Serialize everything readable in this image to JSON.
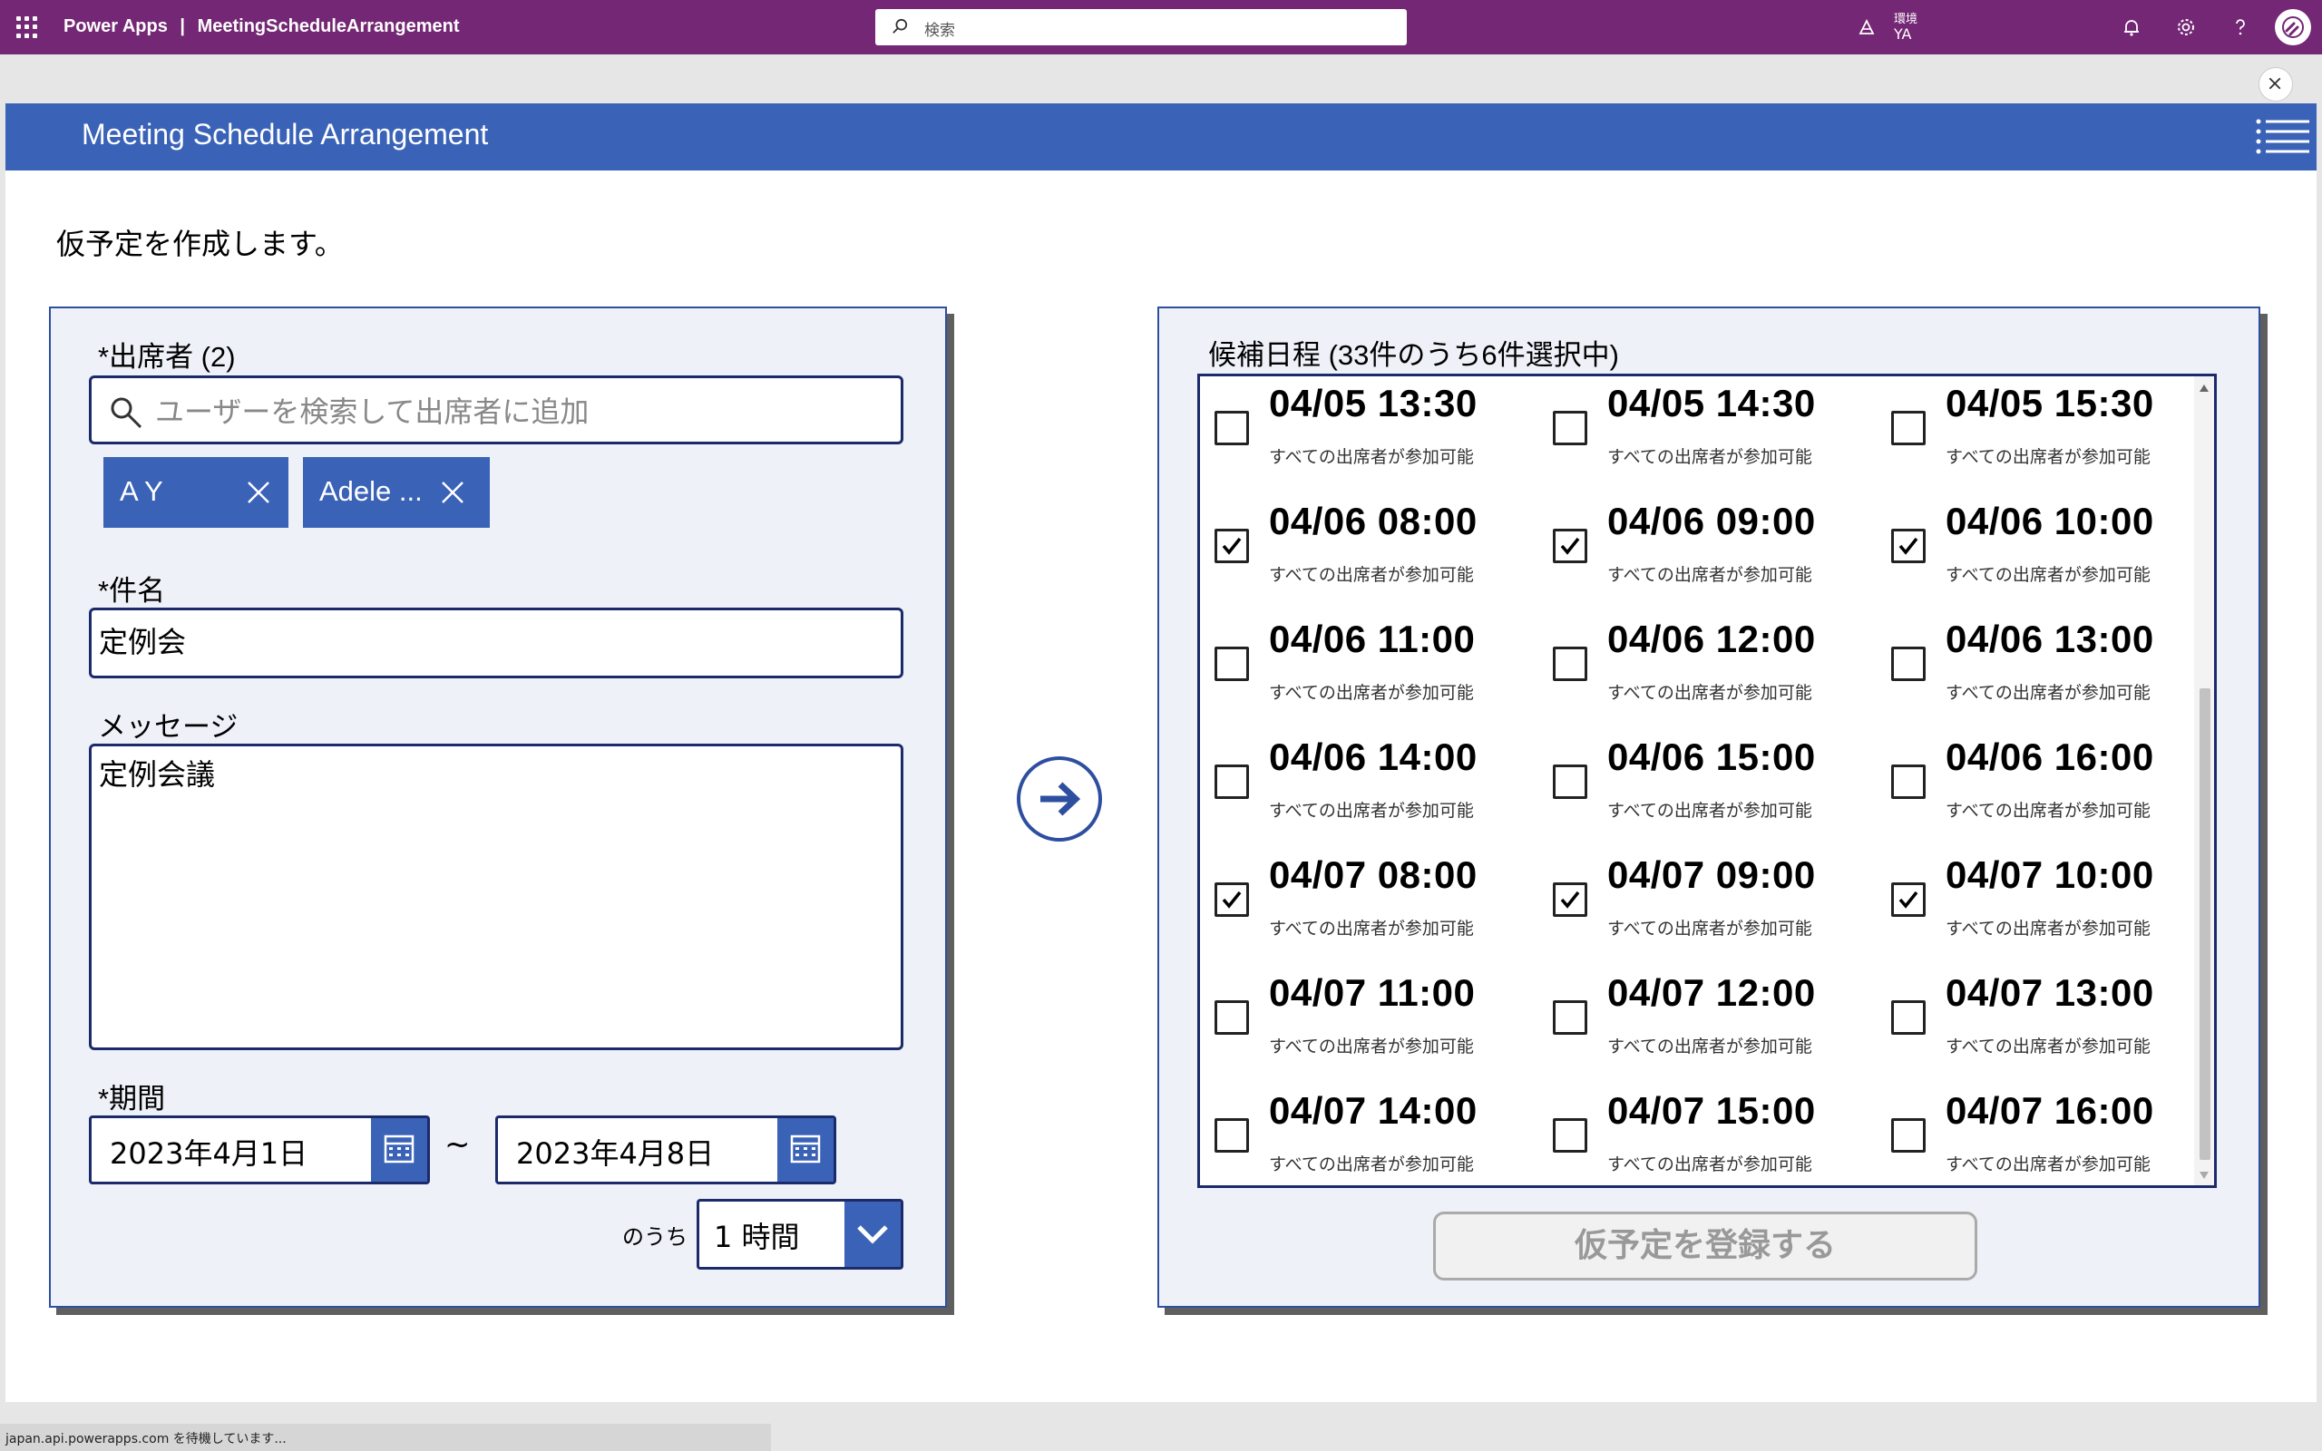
{
  "topbar": {
    "app_name": "Power Apps",
    "separator": "|",
    "app_title": "MeetingScheduleArrangement",
    "search_placeholder": "検索",
    "env_label": "環境",
    "env_value": "YA"
  },
  "app": {
    "header_title": "Meeting Schedule Arrangement",
    "intro": "仮予定を作成します。",
    "attendees": {
      "label": "*出席者 (2)",
      "search_placeholder": "ユーザーを検索して出席者に追加",
      "chips": [
        "A Y",
        "Adele ..."
      ]
    },
    "subject": {
      "label": "*件名",
      "value": "定例会"
    },
    "message": {
      "label": "メッセージ",
      "value": "定例会議"
    },
    "period": {
      "label": "*期間",
      "start": "2023年4月1日",
      "separator": "~",
      "end": "2023年4月8日",
      "duration_prefix": "のうち",
      "duration": "1 時間"
    },
    "candidates": {
      "label": "候補日程 (33件のうち6件選択中)",
      "availability_text": "すべての出席者が参加可能",
      "slots": [
        {
          "time": "04/05 13:30",
          "checked": false
        },
        {
          "time": "04/05 14:30",
          "checked": false
        },
        {
          "time": "04/05 15:30",
          "checked": false
        },
        {
          "time": "04/06 08:00",
          "checked": true
        },
        {
          "time": "04/06 09:00",
          "checked": true
        },
        {
          "time": "04/06 10:00",
          "checked": true
        },
        {
          "time": "04/06 11:00",
          "checked": false
        },
        {
          "time": "04/06 12:00",
          "checked": false
        },
        {
          "time": "04/06 13:00",
          "checked": false
        },
        {
          "time": "04/06 14:00",
          "checked": false
        },
        {
          "time": "04/06 15:00",
          "checked": false
        },
        {
          "time": "04/06 16:00",
          "checked": false
        },
        {
          "time": "04/07 08:00",
          "checked": true
        },
        {
          "time": "04/07 09:00",
          "checked": true
        },
        {
          "time": "04/07 10:00",
          "checked": true
        },
        {
          "time": "04/07 11:00",
          "checked": false
        },
        {
          "time": "04/07 12:00",
          "checked": false
        },
        {
          "time": "04/07 13:00",
          "checked": false
        },
        {
          "time": "04/07 14:00",
          "checked": false
        },
        {
          "time": "04/07 15:00",
          "checked": false
        },
        {
          "time": "04/07 16:00",
          "checked": false
        }
      ]
    },
    "register_button": "仮予定を登録する"
  },
  "status_bar": "japan.api.powerapps.com を待機しています...",
  "colors": {
    "topbar": "#742774",
    "header": "#3a63b8",
    "panel_bg": "#eef1f8",
    "border": "#1b2a6b"
  },
  "icons": [
    "waffle-icon",
    "search-icon",
    "environment-icon",
    "bell-icon",
    "gear-icon",
    "help-icon",
    "avatar",
    "close-icon",
    "hamburger-menu-icon",
    "calendar-icon",
    "chevron-down-icon",
    "arrow-right-icon",
    "checkbox-checked-icon"
  ]
}
